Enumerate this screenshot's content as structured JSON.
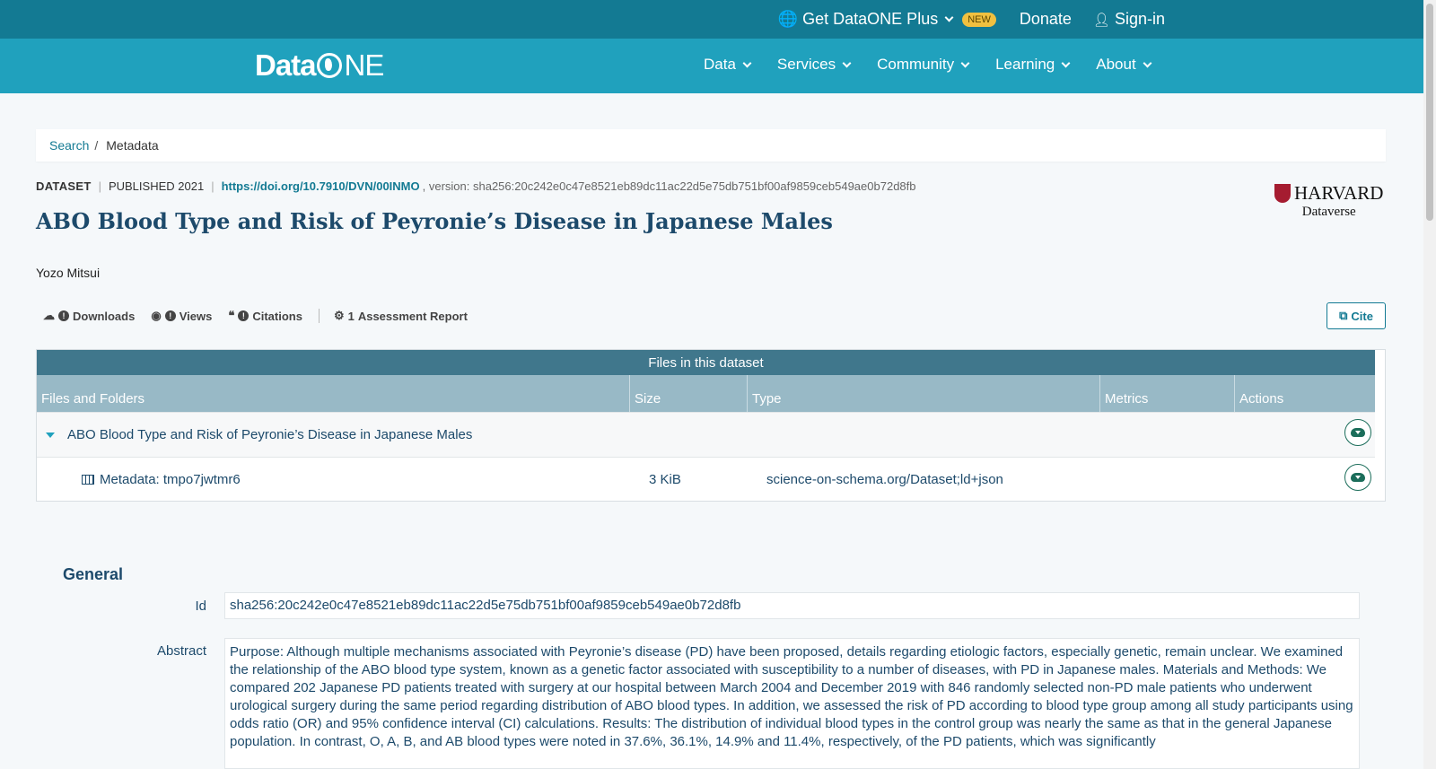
{
  "topbar": {
    "plus_label": "Get DataONE Plus",
    "new_badge": "NEW",
    "donate_label": "Donate",
    "signin_label": "Sign-in"
  },
  "logo": {
    "data": "Data",
    "one": "NE"
  },
  "menu": [
    "Data",
    "Services",
    "Community",
    "Learning",
    "About"
  ],
  "breadcrumb": {
    "search": "Search",
    "separator": "/",
    "current": "Metadata"
  },
  "meta": {
    "type": "DATASET",
    "published": "PUBLISHED 2021",
    "doi": "https://doi.org/10.7910/DVN/00INMO",
    "version": ", version: sha256:20c242e0c47e8521eb89dc11ac22d5e75db751bf00af9859ceb549ae0b72d8fb"
  },
  "title": "ABO Blood Type and Risk of Peyronie’s Disease in Japanese Males",
  "repository": {
    "name": "HARVARD",
    "sub": "Dataverse"
  },
  "author": "Yozo Mitsui",
  "stats": {
    "downloads": "Downloads",
    "views": "Views",
    "citations": "Citations",
    "assessment_count": "1",
    "assessment": "Assessment Report",
    "unknown_glyph": "!"
  },
  "cite_label": "Cite",
  "files": {
    "heading": "Files in this dataset",
    "columns": [
      "Files and Folders",
      "Size",
      "Type",
      "Metrics",
      "Actions"
    ],
    "package_name": "ABO Blood Type and Risk of Peyronie’s Disease in Japanese Males",
    "file": {
      "name": "Metadata: tmpo7jwtmr6",
      "size": "3 KiB",
      "type": "science-on-schema.org/Dataset;ld+json"
    }
  },
  "general": {
    "heading": "General",
    "id_label": "Id",
    "id_value": "sha256:20c242e0c47e8521eb89dc11ac22d5e75db751bf00af9859ceb549ae0b72d8fb",
    "abstract_label": "Abstract",
    "abstract_value": "Purpose: Although multiple mechanisms associated with Peyronie’s disease (PD) have been proposed, details regarding etiologic factors, especially genetic, remain unclear. We examined the relationship of the ABO blood type system, known as a genetic factor associated with susceptibility to a number of diseases, with PD in Japanese males. Materials and Methods: We compared 202 Japanese PD patients treated with surgery at our hospital between March 2004 and December 2019 with 846 randomly selected non-PD male patients who underwent urological surgery during the same period regarding distribution of ABO blood types. In addition, we assessed the risk of PD according to blood type group among all study participants using odds ratio (OR) and 95% confidence interval (CI) calculations. Results: The distribution of individual blood types in the control group was nearly the same as that in the general Japanese population. In contrast, O, A, B, and AB blood types were noted in 37.6%, 36.1%, 14.9% and 11.4%, respectively, of the PD patients, which was significantly"
  },
  "colors": {
    "topbar": "#137a93",
    "nav": "#20a1bd",
    "table_header": "#40778c",
    "accent": "#137a93"
  }
}
